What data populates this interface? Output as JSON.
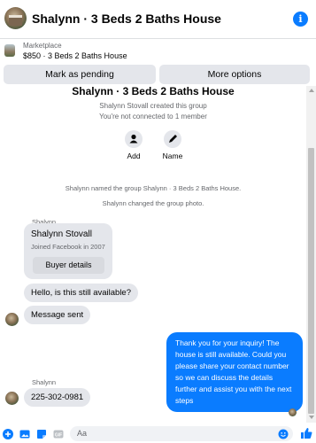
{
  "header": {
    "title": "Shalynn · 3 Beds 2 Baths House",
    "info_icon": "info-icon"
  },
  "marketplace": {
    "label": "Marketplace",
    "listing": "$850 · 3 Beds 2 Baths House"
  },
  "actions": {
    "mark_pending": "Mark as pending",
    "more_options": "More options"
  },
  "group": {
    "title": "Shalynn · 3 Beds 2 Baths House",
    "created": "Shalynn Stovall created this group",
    "connection": "You're not connected to 1 member",
    "add_label": "Add",
    "name_label": "Name"
  },
  "system": {
    "named": "Shalynn named the group Shalynn · 3 Beds 2 Baths House.",
    "photo": "Shalynn changed the group photo."
  },
  "messages": {
    "sender_1": "Shalynn",
    "card_name": "Shalynn Stovall",
    "card_joined": "Joined Facebook in 2007",
    "buyer_details": "Buyer details",
    "msg_available": "Hello, is this still available?",
    "msg_sent": "Message sent",
    "msg_reply": "Thank you for your inquiry! The house is still available. Could you please share your contact number so we can discuss the details further and assist you with the next steps",
    "sender_2": "Shalynn",
    "msg_phone": "225-302-0981"
  },
  "composer": {
    "placeholder": "Aa"
  },
  "colors": {
    "accent": "#0a7cff",
    "bubble_gray": "#e4e6eb"
  }
}
